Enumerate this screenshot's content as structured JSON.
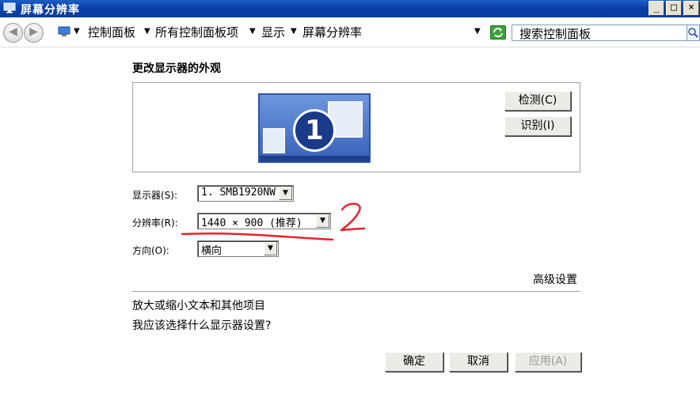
{
  "window": {
    "title": "屏幕分辨率",
    "minimize": "_",
    "maximize": "□",
    "close": "×"
  },
  "address_bar": {
    "back_icon": "back-arrow-icon",
    "forward_icon": "forward-arrow-icon",
    "breadcrumbs": [
      "控制面板",
      "所有控制面板项",
      "显示",
      "屏幕分辨率"
    ],
    "search_placeholder": "搜索控制面板"
  },
  "main": {
    "heading": "更改显示器的外观",
    "monitor_number": "1",
    "detect_button": "检测(C)",
    "identify_button": "识别(I)",
    "display_label": "显示器(S):",
    "display_value": "1. SMB1920NW",
    "resolution_label": "分辨率(R):",
    "resolution_value": "1440 × 900 (推荐)",
    "orientation_label": "方向(O):",
    "orientation_value": "横向",
    "advanced_link": "高级设置",
    "text_size_link": "放大或缩小文本和其他项目",
    "which_settings_link": "我应该选择什么显示器设置?",
    "ok_button": "确定",
    "cancel_button": "取消",
    "apply_button": "应用(A)"
  },
  "annotation": {
    "handwritten_number": "2",
    "color": "#e8212a"
  }
}
